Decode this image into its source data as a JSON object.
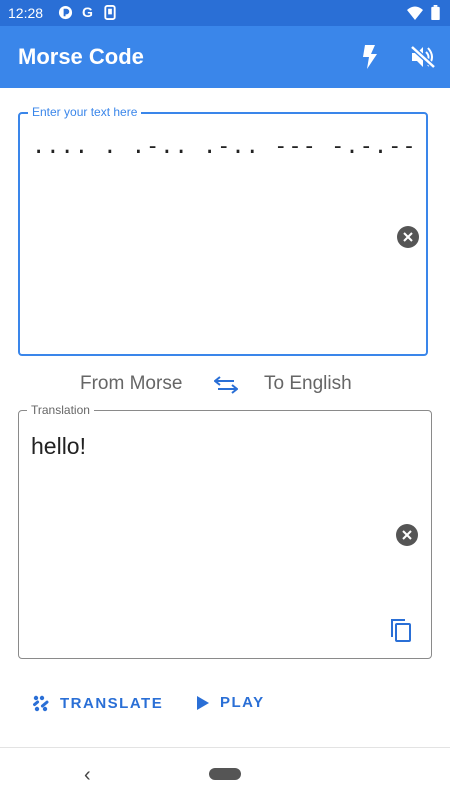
{
  "status_bar": {
    "time": "12:28",
    "left_icons": [
      "pocket-casts-icon",
      "google-icon",
      "phone-icon"
    ],
    "right_icons": [
      "wifi-icon",
      "battery-icon"
    ]
  },
  "app_bar": {
    "title": "Morse Code",
    "actions": [
      "flash-icon",
      "volume-off-icon"
    ],
    "bg_color": "#3a86ea"
  },
  "input": {
    "label": "Enter your text here",
    "value": ".... . .-.. .-.. --- -.-.--"
  },
  "direction": {
    "from": "From Morse",
    "to": "To English",
    "swap_icon": "swap-icon"
  },
  "output": {
    "label": "Translation",
    "value": "hello!"
  },
  "actions": {
    "translate_label": "TRANSLATE",
    "play_label": "PLAY"
  },
  "colors": {
    "accent": "#2a6fd6",
    "status_bar": "#2a6fd6"
  }
}
